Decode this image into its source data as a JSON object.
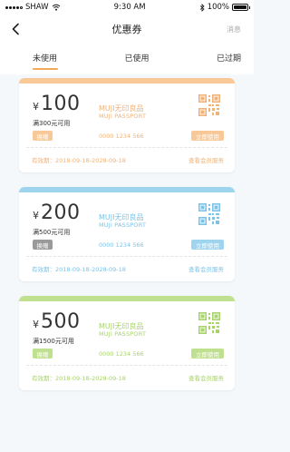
{
  "status_bar": {
    "carrier": "SHAW",
    "time": "9:30 AM",
    "battery": "100%"
  },
  "nav": {
    "title": "优惠券",
    "action": "消息"
  },
  "tabs": [
    {
      "label": "未使用",
      "active": true
    },
    {
      "label": "已使用",
      "active": false
    },
    {
      "label": "已过期",
      "active": false
    }
  ],
  "coupons": [
    {
      "currency": "¥",
      "amount": "100",
      "condition": "满300元可用",
      "exchange_label": "换赠",
      "use_label": "立即使用",
      "brand": "MUJI无印良品",
      "brand_sub": "MUJI PASSPORT",
      "code": "0000 1234 566",
      "validity": "有效期：2018-09-18-2028-09-18",
      "service_link": "查看会员服务",
      "accent": "#f8c896",
      "accent_text": "#f0b277",
      "exchange_color": "#f8c896"
    },
    {
      "currency": "¥",
      "amount": "200",
      "condition": "满500元可用",
      "exchange_label": "换赠",
      "use_label": "立即使用",
      "brand": "MUJI无印良品",
      "brand_sub": "MUJI PASSPORT",
      "code": "0000 1234 566",
      "validity": "有效期：2018-09-18-2028-09-18",
      "service_link": "查看会员服务",
      "accent": "#9fd4ef",
      "accent_text": "#7cc3e8",
      "exchange_color": "#9a9a9a"
    },
    {
      "currency": "¥",
      "amount": "500",
      "condition": "满1500元可用",
      "exchange_label": "换赠",
      "use_label": "立即使用",
      "brand": "MUJI无印良品",
      "brand_sub": "MUJI PASSPORT",
      "code": "0000 1234 566",
      "validity": "有效期：2018-09-18-2028-09-18",
      "service_link": "查看会员服务",
      "accent": "#bfe08e",
      "accent_text": "#a8d36b",
      "exchange_color": "#bfe08e"
    }
  ]
}
